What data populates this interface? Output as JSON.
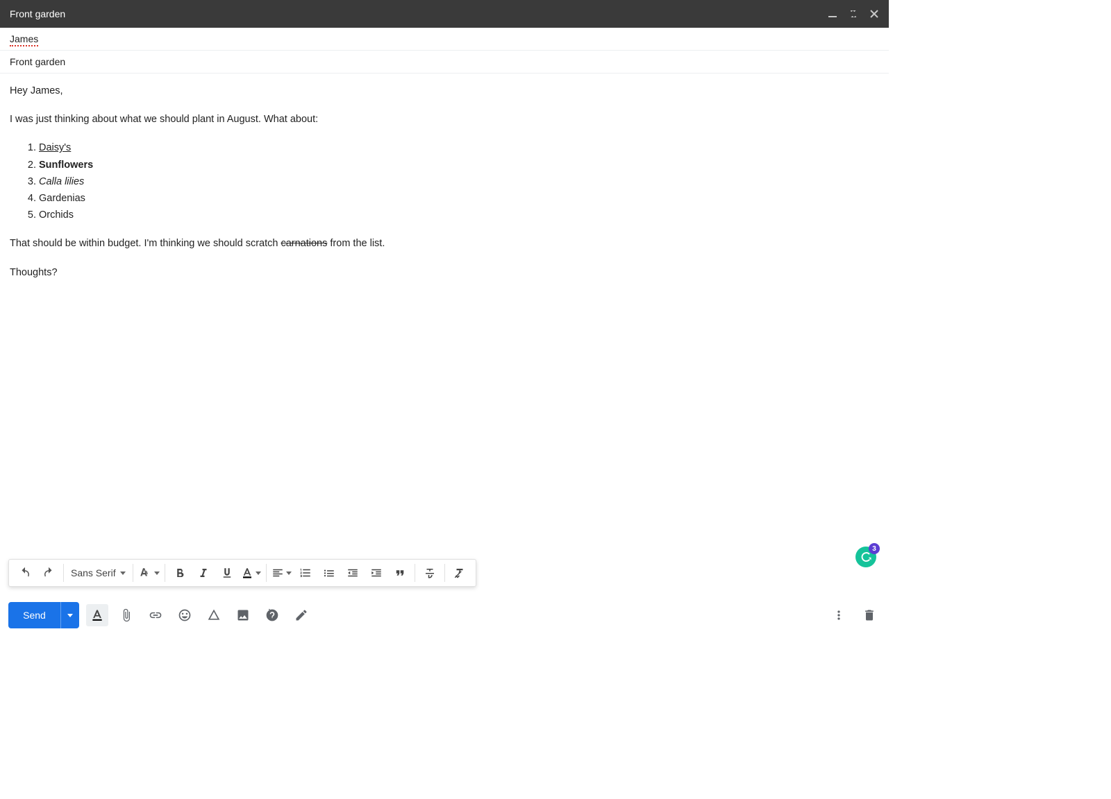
{
  "window": {
    "title": "Front garden"
  },
  "compose": {
    "recipient": "James",
    "subject": "Front garden",
    "body": {
      "greeting": "Hey James,",
      "intro": "I was just thinking about what we should plant in August. What about:",
      "list": [
        "Daisy's",
        "Sunflowers",
        "Calla lilies",
        "Gardenias",
        "Orchids"
      ],
      "budget_pre": "That should be within budget. I'm thinking we should scratch ",
      "budget_strike": "carnations",
      "budget_post": " from the list.",
      "closing": "Thoughts?"
    }
  },
  "toolbar": {
    "font": "Sans Serif"
  },
  "actions": {
    "send": "Send"
  },
  "grammarly": {
    "count": "3"
  }
}
